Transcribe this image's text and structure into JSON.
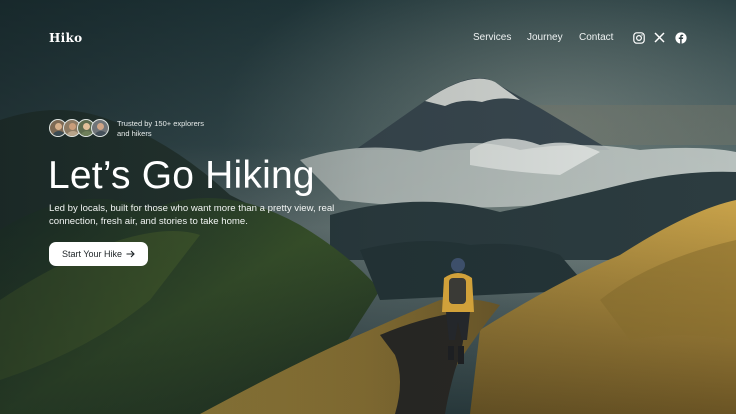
{
  "brand": {
    "logo": "Hiko"
  },
  "nav": {
    "links": [
      {
        "label": "Services"
      },
      {
        "label": "Journey"
      },
      {
        "label": "Contact"
      }
    ],
    "social": [
      "instagram-icon",
      "x-icon",
      "facebook-icon"
    ]
  },
  "trust": {
    "text": "Trusted by 150+ explorers and hikers",
    "avatars": 4
  },
  "hero": {
    "title": "Let’s Go Hiking",
    "subtitle": "Led by locals, built for those who want more than a pretty view, real connection, fresh air, and stories to take home.",
    "cta_label": "Start Your Hike"
  },
  "colors": {
    "text": "#ffffff",
    "button_bg": "#ffffff",
    "button_text": "#1d2326",
    "sky": "#2f4549",
    "grass": "#c9a34a"
  }
}
